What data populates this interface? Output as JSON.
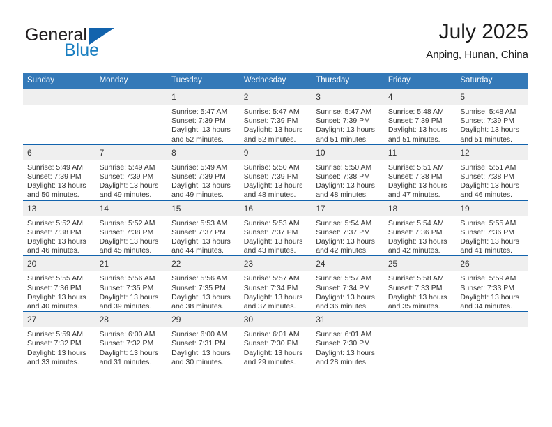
{
  "brand": {
    "name_part1": "General",
    "name_part2": "Blue",
    "triangle_color": "#1263ad",
    "blue_color": "#1a7fc1"
  },
  "header": {
    "title": "July 2025",
    "location": "Anping, Hunan, China"
  },
  "theme": {
    "header_bg": "#3479b8",
    "row_border": "#1263ad",
    "daynum_bg": "#efefef",
    "text": "#333333"
  },
  "weekday_headers": [
    "Sunday",
    "Monday",
    "Tuesday",
    "Wednesday",
    "Thursday",
    "Friday",
    "Saturday"
  ],
  "labels": {
    "sunrise_prefix": "Sunrise:",
    "sunset_prefix": "Sunset:",
    "daylight_prefix": "Daylight:"
  },
  "weeks": [
    [
      {
        "day": "",
        "blank": true
      },
      {
        "day": "",
        "blank": true
      },
      {
        "day": "1",
        "sunrise": "Sunrise: 5:47 AM",
        "sunset": "Sunset: 7:39 PM",
        "daylight": "Daylight: 13 hours and 52 minutes."
      },
      {
        "day": "2",
        "sunrise": "Sunrise: 5:47 AM",
        "sunset": "Sunset: 7:39 PM",
        "daylight": "Daylight: 13 hours and 52 minutes."
      },
      {
        "day": "3",
        "sunrise": "Sunrise: 5:47 AM",
        "sunset": "Sunset: 7:39 PM",
        "daylight": "Daylight: 13 hours and 51 minutes."
      },
      {
        "day": "4",
        "sunrise": "Sunrise: 5:48 AM",
        "sunset": "Sunset: 7:39 PM",
        "daylight": "Daylight: 13 hours and 51 minutes."
      },
      {
        "day": "5",
        "sunrise": "Sunrise: 5:48 AM",
        "sunset": "Sunset: 7:39 PM",
        "daylight": "Daylight: 13 hours and 51 minutes."
      }
    ],
    [
      {
        "day": "6",
        "sunrise": "Sunrise: 5:49 AM",
        "sunset": "Sunset: 7:39 PM",
        "daylight": "Daylight: 13 hours and 50 minutes."
      },
      {
        "day": "7",
        "sunrise": "Sunrise: 5:49 AM",
        "sunset": "Sunset: 7:39 PM",
        "daylight": "Daylight: 13 hours and 49 minutes."
      },
      {
        "day": "8",
        "sunrise": "Sunrise: 5:49 AM",
        "sunset": "Sunset: 7:39 PM",
        "daylight": "Daylight: 13 hours and 49 minutes."
      },
      {
        "day": "9",
        "sunrise": "Sunrise: 5:50 AM",
        "sunset": "Sunset: 7:39 PM",
        "daylight": "Daylight: 13 hours and 48 minutes."
      },
      {
        "day": "10",
        "sunrise": "Sunrise: 5:50 AM",
        "sunset": "Sunset: 7:38 PM",
        "daylight": "Daylight: 13 hours and 48 minutes."
      },
      {
        "day": "11",
        "sunrise": "Sunrise: 5:51 AM",
        "sunset": "Sunset: 7:38 PM",
        "daylight": "Daylight: 13 hours and 47 minutes."
      },
      {
        "day": "12",
        "sunrise": "Sunrise: 5:51 AM",
        "sunset": "Sunset: 7:38 PM",
        "daylight": "Daylight: 13 hours and 46 minutes."
      }
    ],
    [
      {
        "day": "13",
        "sunrise": "Sunrise: 5:52 AM",
        "sunset": "Sunset: 7:38 PM",
        "daylight": "Daylight: 13 hours and 46 minutes."
      },
      {
        "day": "14",
        "sunrise": "Sunrise: 5:52 AM",
        "sunset": "Sunset: 7:38 PM",
        "daylight": "Daylight: 13 hours and 45 minutes."
      },
      {
        "day": "15",
        "sunrise": "Sunrise: 5:53 AM",
        "sunset": "Sunset: 7:37 PM",
        "daylight": "Daylight: 13 hours and 44 minutes."
      },
      {
        "day": "16",
        "sunrise": "Sunrise: 5:53 AM",
        "sunset": "Sunset: 7:37 PM",
        "daylight": "Daylight: 13 hours and 43 minutes."
      },
      {
        "day": "17",
        "sunrise": "Sunrise: 5:54 AM",
        "sunset": "Sunset: 7:37 PM",
        "daylight": "Daylight: 13 hours and 42 minutes."
      },
      {
        "day": "18",
        "sunrise": "Sunrise: 5:54 AM",
        "sunset": "Sunset: 7:36 PM",
        "daylight": "Daylight: 13 hours and 42 minutes."
      },
      {
        "day": "19",
        "sunrise": "Sunrise: 5:55 AM",
        "sunset": "Sunset: 7:36 PM",
        "daylight": "Daylight: 13 hours and 41 minutes."
      }
    ],
    [
      {
        "day": "20",
        "sunrise": "Sunrise: 5:55 AM",
        "sunset": "Sunset: 7:36 PM",
        "daylight": "Daylight: 13 hours and 40 minutes."
      },
      {
        "day": "21",
        "sunrise": "Sunrise: 5:56 AM",
        "sunset": "Sunset: 7:35 PM",
        "daylight": "Daylight: 13 hours and 39 minutes."
      },
      {
        "day": "22",
        "sunrise": "Sunrise: 5:56 AM",
        "sunset": "Sunset: 7:35 PM",
        "daylight": "Daylight: 13 hours and 38 minutes."
      },
      {
        "day": "23",
        "sunrise": "Sunrise: 5:57 AM",
        "sunset": "Sunset: 7:34 PM",
        "daylight": "Daylight: 13 hours and 37 minutes."
      },
      {
        "day": "24",
        "sunrise": "Sunrise: 5:57 AM",
        "sunset": "Sunset: 7:34 PM",
        "daylight": "Daylight: 13 hours and 36 minutes."
      },
      {
        "day": "25",
        "sunrise": "Sunrise: 5:58 AM",
        "sunset": "Sunset: 7:33 PM",
        "daylight": "Daylight: 13 hours and 35 minutes."
      },
      {
        "day": "26",
        "sunrise": "Sunrise: 5:59 AM",
        "sunset": "Sunset: 7:33 PM",
        "daylight": "Daylight: 13 hours and 34 minutes."
      }
    ],
    [
      {
        "day": "27",
        "sunrise": "Sunrise: 5:59 AM",
        "sunset": "Sunset: 7:32 PM",
        "daylight": "Daylight: 13 hours and 33 minutes."
      },
      {
        "day": "28",
        "sunrise": "Sunrise: 6:00 AM",
        "sunset": "Sunset: 7:32 PM",
        "daylight": "Daylight: 13 hours and 31 minutes."
      },
      {
        "day": "29",
        "sunrise": "Sunrise: 6:00 AM",
        "sunset": "Sunset: 7:31 PM",
        "daylight": "Daylight: 13 hours and 30 minutes."
      },
      {
        "day": "30",
        "sunrise": "Sunrise: 6:01 AM",
        "sunset": "Sunset: 7:30 PM",
        "daylight": "Daylight: 13 hours and 29 minutes."
      },
      {
        "day": "31",
        "sunrise": "Sunrise: 6:01 AM",
        "sunset": "Sunset: 7:30 PM",
        "daylight": "Daylight: 13 hours and 28 minutes."
      },
      {
        "day": "",
        "blank": true
      },
      {
        "day": "",
        "blank": true
      }
    ]
  ]
}
